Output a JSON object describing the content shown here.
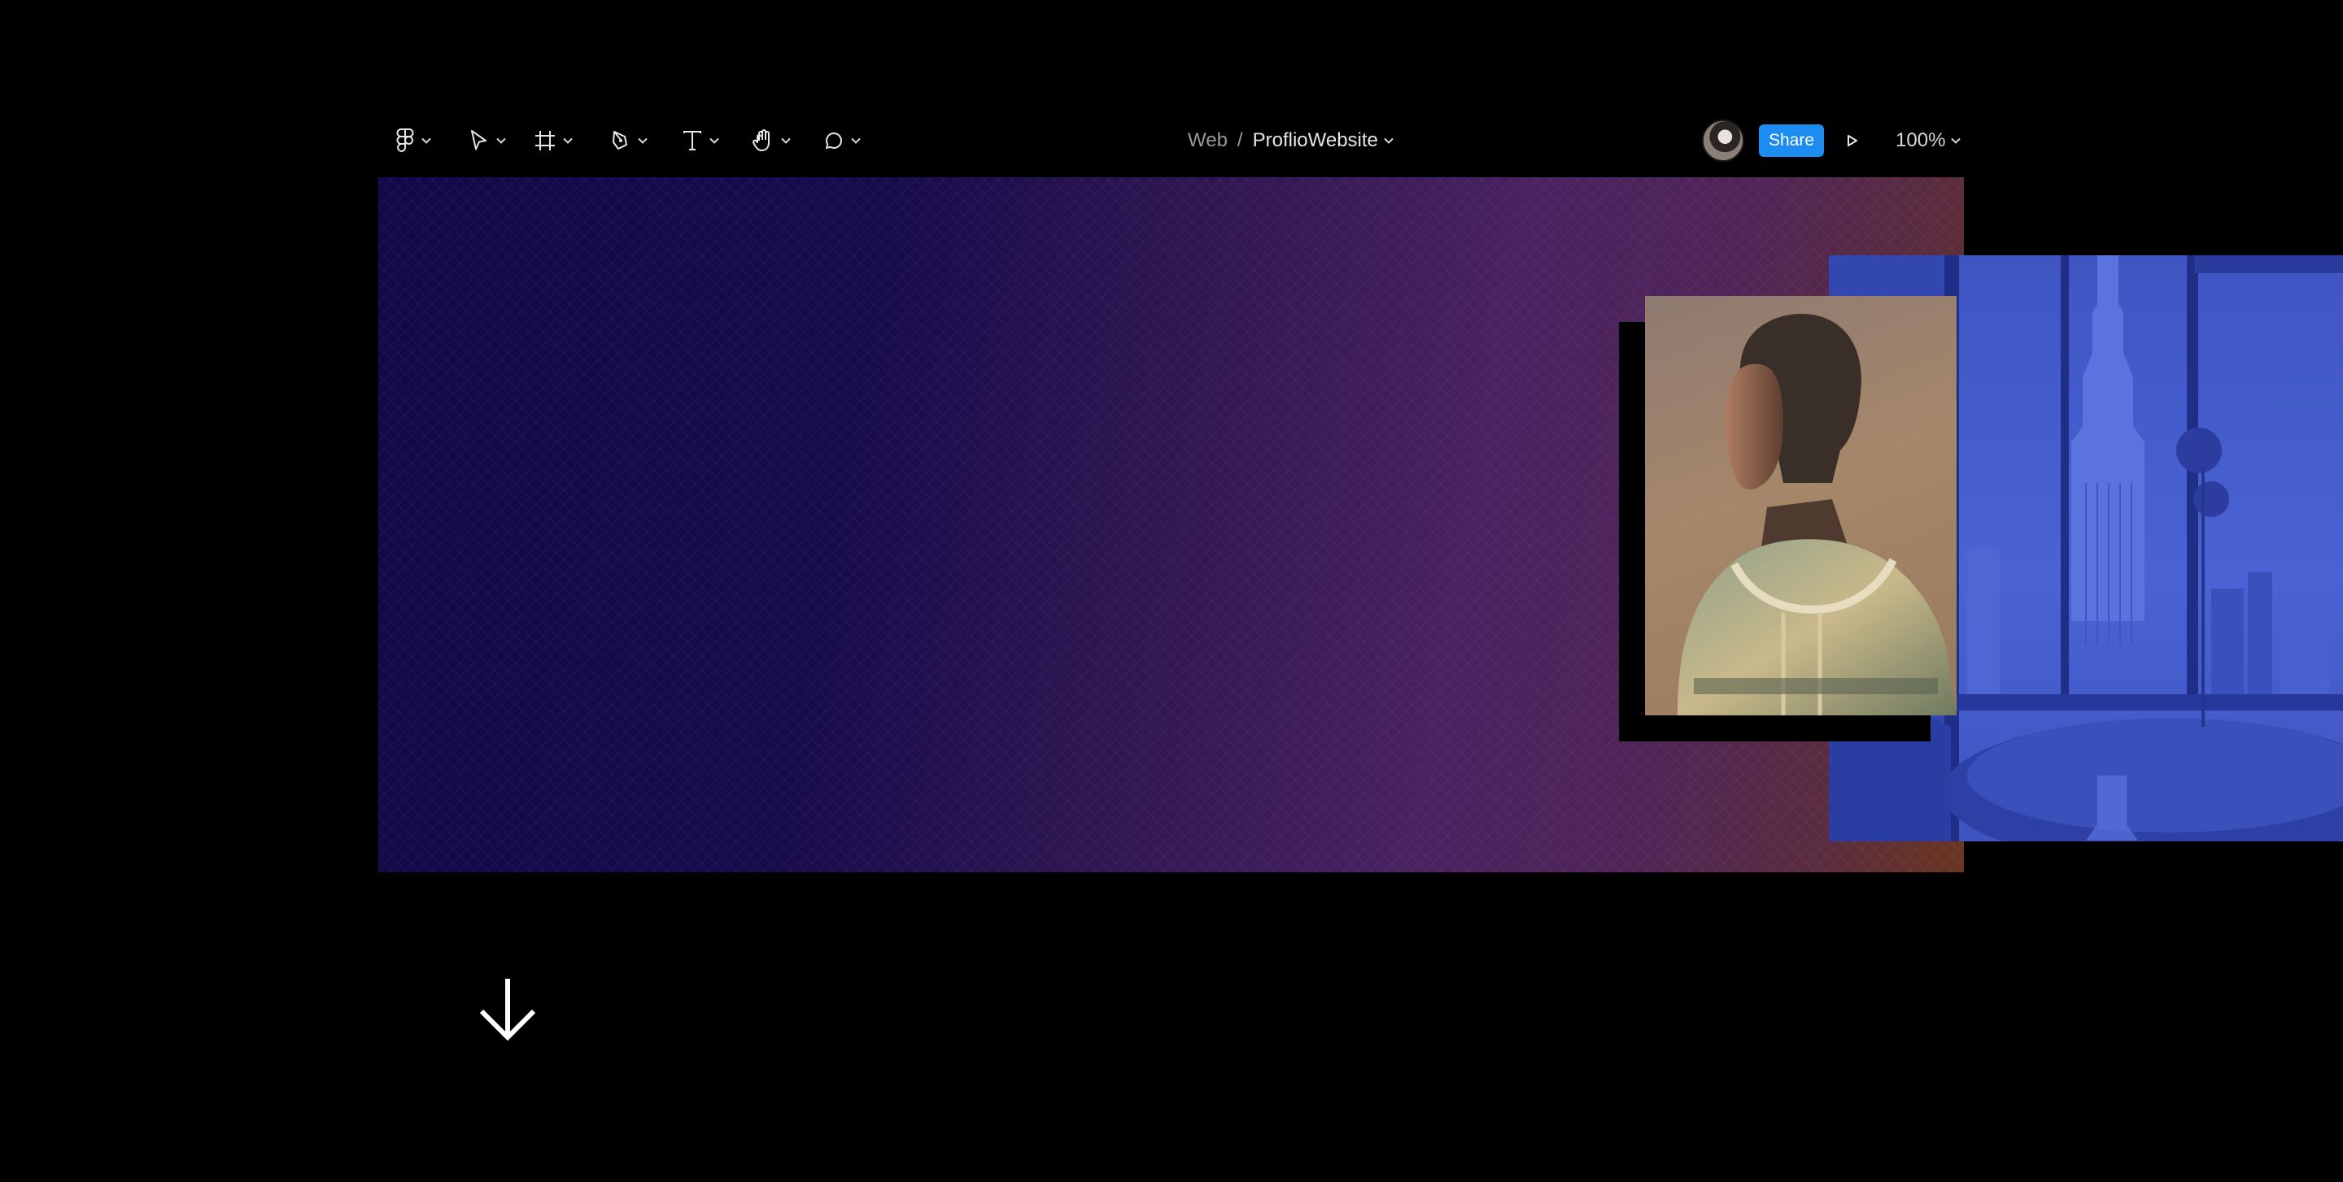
{
  "toolbar": {
    "tools": [
      {
        "id": "main-menu",
        "icon": "figma-logo-icon"
      },
      {
        "id": "move",
        "icon": "move-cursor-icon"
      },
      {
        "id": "frame",
        "icon": "frame-icon"
      },
      {
        "id": "pen",
        "icon": "pen-icon"
      },
      {
        "id": "text",
        "icon": "text-icon"
      },
      {
        "id": "hand",
        "icon": "hand-icon"
      },
      {
        "id": "comment",
        "icon": "comment-icon"
      }
    ],
    "breadcrumb": {
      "team": "Web",
      "separator": "/",
      "project": "ProflioWebsite"
    },
    "share_label": "Share",
    "zoom_level": "100%",
    "accent_color": "#1c8cf0"
  },
  "canvas": {
    "hero_gradient": [
      "#12094a",
      "#4a2260",
      "#6b3520"
    ],
    "city_tint": "#4a62d4"
  }
}
